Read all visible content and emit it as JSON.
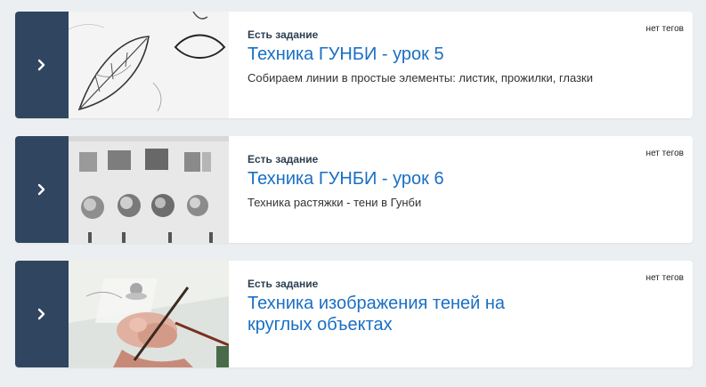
{
  "theme": {
    "expand_button_color": "#304560",
    "title_color": "#1a6fc4",
    "background": "#eceff1"
  },
  "lessons": [
    {
      "status": "Есть задание",
      "title": "Техника ГУНБИ - урок 5",
      "description": "Собираем линии в простые элементы: листик, прожилки, глазки",
      "tags": "нет тегов",
      "thumbnail": "leaf-sketch-image"
    },
    {
      "status": "Есть задание",
      "title": "Техника ГУНБИ - урок 6",
      "description": "Техника растяжки - тени в Гунби",
      "tags": "нет тегов",
      "thumbnail": "shading-exercises-image"
    },
    {
      "status": "Есть задание",
      "title": "Техника изображения теней на круглых объектах",
      "description": "",
      "tags": "нет тегов",
      "thumbnail": "painting-hand-image"
    }
  ]
}
